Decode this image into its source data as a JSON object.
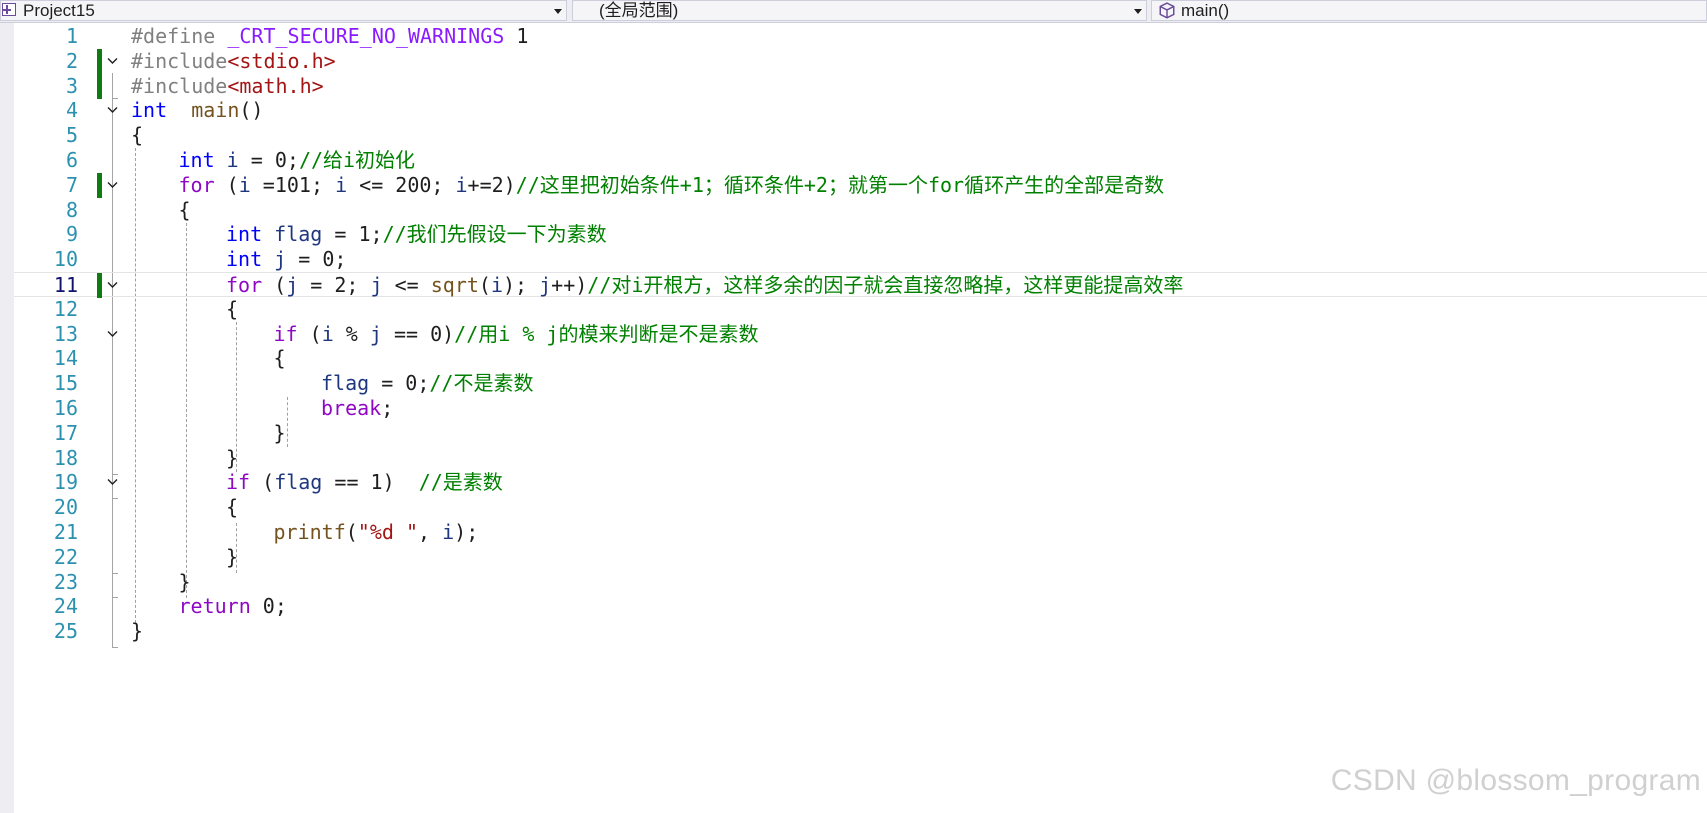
{
  "toolbar": {
    "project": "Project15",
    "scope": "(全局范围)",
    "member": "main()"
  },
  "editor": {
    "current_line": 11,
    "changed_lines": [
      2,
      3,
      7,
      11
    ],
    "fold_markers": [
      2,
      4,
      7,
      11,
      13,
      19
    ],
    "lines": [
      {
        "n": "1",
        "ind": 0,
        "toks": [
          [
            "pp",
            "#define "
          ],
          [
            "mac",
            "_CRT_SECURE_NO_WARNINGS"
          ],
          [
            "num",
            " 1"
          ]
        ]
      },
      {
        "n": "2",
        "ind": 0,
        "toks": [
          [
            "pp",
            "#include"
          ],
          [
            "inc",
            "<stdio.h>"
          ]
        ]
      },
      {
        "n": "3",
        "ind": 0,
        "toks": [
          [
            "pp",
            "#include"
          ],
          [
            "inc",
            "<math.h>"
          ]
        ]
      },
      {
        "n": "4",
        "ind": 0,
        "toks": [
          [
            "kw",
            "int"
          ],
          [
            "",
            "  "
          ],
          [
            "fn",
            "main"
          ],
          [
            "",
            "()"
          ]
        ]
      },
      {
        "n": "5",
        "ind": 0,
        "toks": [
          [
            "",
            "{"
          ]
        ]
      },
      {
        "n": "6",
        "ind": 1,
        "toks": [
          [
            "kw",
            "int"
          ],
          [
            "",
            " "
          ],
          [
            "var",
            "i"
          ],
          [
            "",
            " = 0;"
          ],
          [
            "cm",
            "//给i初始化"
          ]
        ]
      },
      {
        "n": "7",
        "ind": 1,
        "toks": [
          [
            "ctl",
            "for"
          ],
          [
            "",
            " ("
          ],
          [
            "var",
            "i"
          ],
          [
            "",
            " =101; "
          ],
          [
            "var",
            "i"
          ],
          [
            "",
            " <= 200; "
          ],
          [
            "var",
            "i"
          ],
          [
            "",
            "+=2)"
          ],
          [
            "cm",
            "//这里把初始条件+1；循环条件+2；就第一个for循环产生的全部是奇数"
          ]
        ]
      },
      {
        "n": "8",
        "ind": 1,
        "toks": [
          [
            "",
            "{"
          ]
        ]
      },
      {
        "n": "9",
        "ind": 2,
        "toks": [
          [
            "kw",
            "int"
          ],
          [
            "",
            " "
          ],
          [
            "var",
            "flag"
          ],
          [
            "",
            " = 1;"
          ],
          [
            "cm",
            "//我们先假设一下为素数"
          ]
        ]
      },
      {
        "n": "10",
        "ind": 2,
        "toks": [
          [
            "kw",
            "int"
          ],
          [
            "",
            " "
          ],
          [
            "var",
            "j"
          ],
          [
            "",
            " = 0;"
          ]
        ]
      },
      {
        "n": "11",
        "ind": 2,
        "toks": [
          [
            "ctl",
            "for"
          ],
          [
            "",
            " ("
          ],
          [
            "var",
            "j"
          ],
          [
            "",
            " = 2; "
          ],
          [
            "var",
            "j"
          ],
          [
            "",
            " <= "
          ],
          [
            "fn",
            "sqrt"
          ],
          [
            "",
            "("
          ],
          [
            "var",
            "i"
          ],
          [
            "",
            "); "
          ],
          [
            "var",
            "j"
          ],
          [
            "",
            "++)"
          ],
          [
            "cm",
            "//对i开根方，这样多余的因子就会直接忽略掉，这样更能提高效率"
          ]
        ]
      },
      {
        "n": "12",
        "ind": 2,
        "toks": [
          [
            "",
            "{"
          ]
        ]
      },
      {
        "n": "13",
        "ind": 3,
        "toks": [
          [
            "ctl",
            "if"
          ],
          [
            "",
            " ("
          ],
          [
            "var",
            "i"
          ],
          [
            "",
            " % "
          ],
          [
            "var",
            "j"
          ],
          [
            "",
            " == 0)"
          ],
          [
            "cm",
            "//用i % j的模来判断是不是素数"
          ]
        ]
      },
      {
        "n": "14",
        "ind": 3,
        "toks": [
          [
            "",
            "{"
          ]
        ]
      },
      {
        "n": "15",
        "ind": 4,
        "toks": [
          [
            "var",
            "flag"
          ],
          [
            "",
            " = 0;"
          ],
          [
            "cm",
            "//不是素数"
          ]
        ]
      },
      {
        "n": "16",
        "ind": 4,
        "toks": [
          [
            "ctl",
            "break"
          ],
          [
            "",
            ";"
          ]
        ]
      },
      {
        "n": "17",
        "ind": 3,
        "toks": [
          [
            "",
            "}"
          ]
        ]
      },
      {
        "n": "18",
        "ind": 2,
        "toks": [
          [
            "",
            "}"
          ]
        ]
      },
      {
        "n": "19",
        "ind": 2,
        "toks": [
          [
            "ctl",
            "if"
          ],
          [
            "",
            " ("
          ],
          [
            "var",
            "flag"
          ],
          [
            "",
            " == 1)  "
          ],
          [
            "cm",
            "//是素数"
          ]
        ]
      },
      {
        "n": "20",
        "ind": 2,
        "toks": [
          [
            "",
            "{"
          ]
        ]
      },
      {
        "n": "21",
        "ind": 3,
        "toks": [
          [
            "fn",
            "printf"
          ],
          [
            "",
            "("
          ],
          [
            "str",
            "\"%d \""
          ],
          [
            "",
            ", "
          ],
          [
            "var",
            "i"
          ],
          [
            "",
            ");"
          ]
        ]
      },
      {
        "n": "22",
        "ind": 2,
        "toks": [
          [
            "",
            "}"
          ]
        ]
      },
      {
        "n": "23",
        "ind": 1,
        "toks": [
          [
            "",
            "}"
          ]
        ]
      },
      {
        "n": "24",
        "ind": 1,
        "toks": [
          [
            "ctl",
            "return"
          ],
          [
            "",
            " 0;"
          ]
        ]
      },
      {
        "n": "25",
        "ind": 0,
        "toks": [
          [
            "",
            "}"
          ]
        ]
      }
    ]
  },
  "watermark": "CSDN @blossom_program"
}
